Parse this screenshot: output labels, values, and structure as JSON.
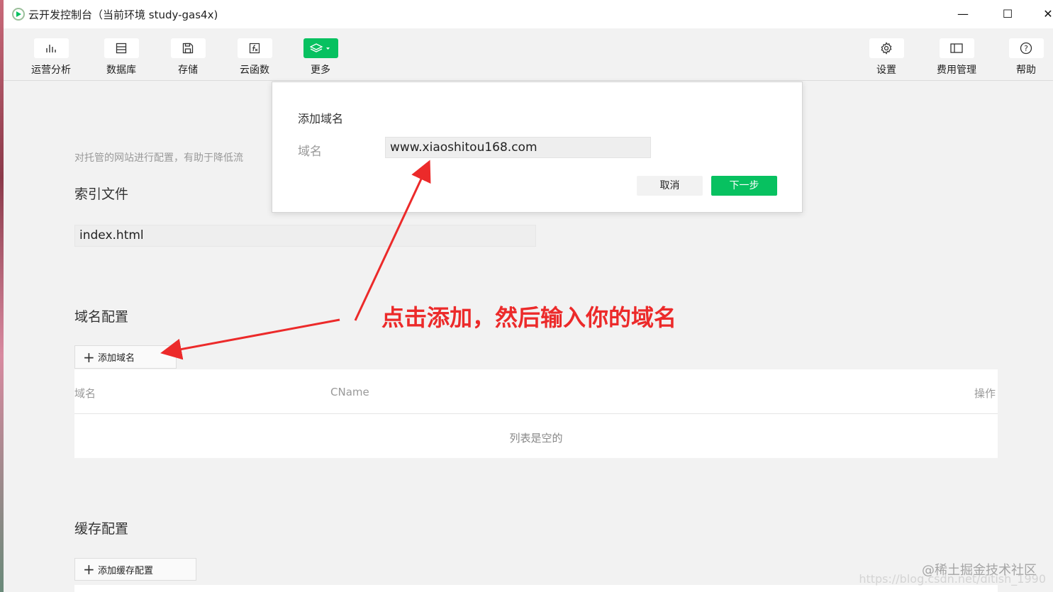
{
  "window": {
    "title": "云开发控制台（当前环境 study-gas4x)",
    "minimize_glyph": "—",
    "maximize_glyph": "☐",
    "close_glyph": "✕"
  },
  "toolbar": {
    "left_items": [
      {
        "label": "运营分析",
        "icon": "bar-chart-icon"
      },
      {
        "label": "数据库",
        "icon": "database-icon"
      },
      {
        "label": "存储",
        "icon": "floppy-disk-icon"
      },
      {
        "label": "云函数",
        "icon": "function-icon"
      },
      {
        "label": "更多",
        "icon": "layers-icon",
        "active": true
      }
    ],
    "right_items": [
      {
        "label": "设置",
        "icon": "gear-icon"
      },
      {
        "label": "费用管理",
        "icon": "panel-icon"
      },
      {
        "label": "帮助",
        "icon": "help-icon"
      }
    ]
  },
  "main": {
    "description": "对托管的网站进行配置，有助于降低流",
    "index_section": {
      "title": "索引文件",
      "value": "index.html"
    },
    "domain_section": {
      "title": "域名配置",
      "add_button": "添加域名",
      "table": {
        "columns": [
          "域名",
          "CName",
          "操作"
        ],
        "empty_text": "列表是空的"
      }
    },
    "cache_section": {
      "title": "缓存配置",
      "add_button": "添加缓存配置"
    }
  },
  "dialog": {
    "title": "添加域名",
    "field_label": "域名",
    "field_value": "www.xiaoshitou168.com",
    "cancel": "取消",
    "next": "下一步"
  },
  "annotation": {
    "text": "点击添加，然后输入你的域名",
    "color": "#ec2a2a"
  },
  "watermark": {
    "line1": "@稀土掘金技术社区",
    "line2": "https://blog.csdn.net/ditish_1990"
  },
  "colors": {
    "accent": "#07c160",
    "annotation": "#ec2a2a"
  }
}
